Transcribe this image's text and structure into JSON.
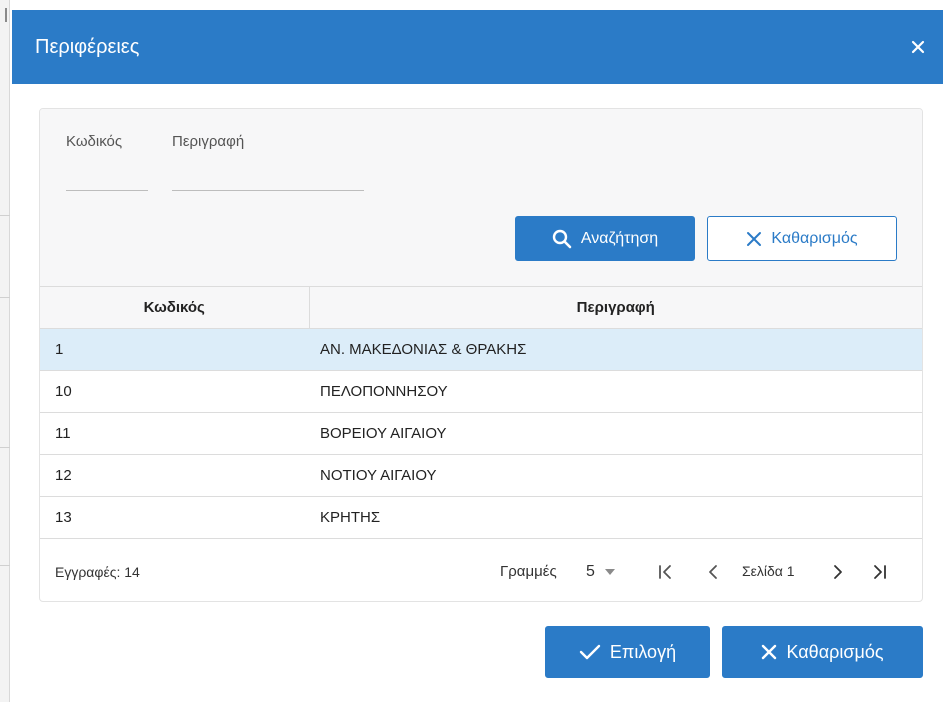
{
  "dialog": {
    "title": "Περιφέρειες",
    "close_icon": "close-icon"
  },
  "filters": {
    "code_label": "Κωδικός",
    "code_value": "",
    "description_label": "Περιγραφή",
    "description_value": "",
    "search_label": "Αναζήτηση",
    "search_icon": "search-icon",
    "clear_label": "Καθαρισμός",
    "clear_icon": "close-icon"
  },
  "table": {
    "columns": [
      "Κωδικός",
      "Περιγραφή"
    ],
    "rows": [
      {
        "code": "1",
        "description": "ΑΝ. ΜΑΚΕΔΟΝΙΑΣ & ΘΡΑΚΗΣ",
        "selected": true
      },
      {
        "code": "10",
        "description": "ΠΕΛΟΠΟΝΝΗΣΟΥ",
        "selected": false
      },
      {
        "code": "11",
        "description": "ΒΟΡΕΙΟΥ ΑΙΓΑΙΟΥ",
        "selected": false
      },
      {
        "code": "12",
        "description": "ΝΟΤΙΟΥ ΑΙΓΑΙΟΥ",
        "selected": false
      },
      {
        "code": "13",
        "description": "ΚΡΗΤΗΣ",
        "selected": false
      }
    ]
  },
  "pagination": {
    "records_text": "Εγγραφές: 14",
    "rows_label": "Γραμμές",
    "rows_per_page": "5",
    "page_text": "Σελίδα 1"
  },
  "actions": {
    "select_label": "Επιλογή",
    "select_icon": "check-icon",
    "clear_label": "Καθαρισμός",
    "clear_icon": "close-icon"
  },
  "colors": {
    "primary": "#2b7bc7",
    "selected_row": "#dcedf9",
    "panel_background": "#f7f7f8",
    "border": "#dcdcdc"
  }
}
